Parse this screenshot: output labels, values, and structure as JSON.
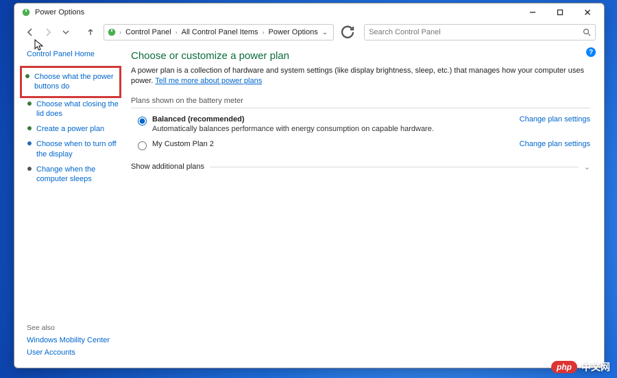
{
  "window": {
    "title": "Power Options",
    "minimize_tooltip": "Minimize",
    "maximize_tooltip": "Maximize",
    "close_tooltip": "Close"
  },
  "nav": {
    "back": "Back",
    "forward": "Forward",
    "recent": "Recent locations",
    "up": "Up"
  },
  "breadcrumb": {
    "item1": "Control Panel",
    "item2": "All Control Panel Items",
    "item3": "Power Options"
  },
  "search": {
    "placeholder": "Search Control Panel"
  },
  "sidebar": {
    "home": "Control Panel Home",
    "items": [
      {
        "label": "Choose what the power buttons do"
      },
      {
        "label": "Choose what closing the lid does"
      },
      {
        "label": "Create a power plan"
      },
      {
        "label": "Choose when to turn off the display"
      },
      {
        "label": "Change when the computer sleeps"
      }
    ],
    "seealso": "See also",
    "bottom1": "Windows Mobility Center",
    "bottom2": "User Accounts"
  },
  "content": {
    "heading": "Choose or customize a power plan",
    "description_pre": "A power plan is a collection of hardware and system settings (like display brightness, sleep, etc.) that manages how your computer uses power. ",
    "description_link": "Tell me more about power plans",
    "meter_label": "Plans shown on the battery meter",
    "plan1": {
      "name": "Balanced (recommended)",
      "sub": "Automatically balances performance with energy consumption on capable hardware.",
      "settings": "Change plan settings"
    },
    "plan2": {
      "name": "My Custom Plan 2",
      "settings": "Change plan settings"
    },
    "expand": "Show additional plans"
  },
  "watermark": {
    "badge": "php",
    "text": "中文网"
  }
}
